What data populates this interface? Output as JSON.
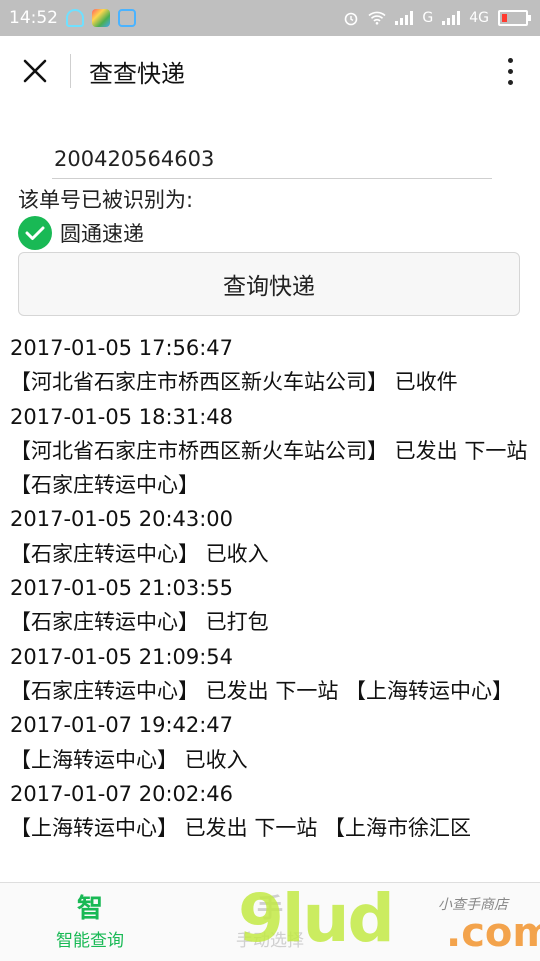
{
  "status_bar": {
    "time": "14:52",
    "network_1": "G",
    "network_2": "4G"
  },
  "header": {
    "title": "查查快递"
  },
  "search": {
    "tracking_number": "200420564603",
    "recognized_label": "该单号已被识别为:",
    "carrier": "圆通速递",
    "query_button": "查询快递"
  },
  "results": [
    "2017-01-05 17:56:47",
    "【河北省石家庄市桥西区新火车站公司】 已收件",
    "2017-01-05 18:31:48",
    "【河北省石家庄市桥西区新火车站公司】 已发出 下一站 【石家庄转运中心】",
    "2017-01-05 20:43:00",
    "【石家庄转运中心】 已收入",
    "2017-01-05 21:03:55",
    "【石家庄转运中心】 已打包",
    "2017-01-05 21:09:54",
    "【石家庄转运中心】 已发出 下一站 【上海转运中心】",
    "2017-01-07 19:42:47",
    "【上海转运中心】 已收入",
    "2017-01-07 20:02:46",
    "【上海转运中心】 已发出 下一站 【上海市徐汇区"
  ],
  "bottom_nav": {
    "items": [
      {
        "icon_char": "智",
        "label": "智能查询"
      },
      {
        "icon_char": "手",
        "label": "手动选择"
      }
    ]
  },
  "watermark": {
    "big": "9lud",
    "small": "小查手商店",
    "suffix": ".com"
  },
  "colors": {
    "accent_green": "#19b955",
    "status_bar_bg": "#bfbfbf"
  }
}
